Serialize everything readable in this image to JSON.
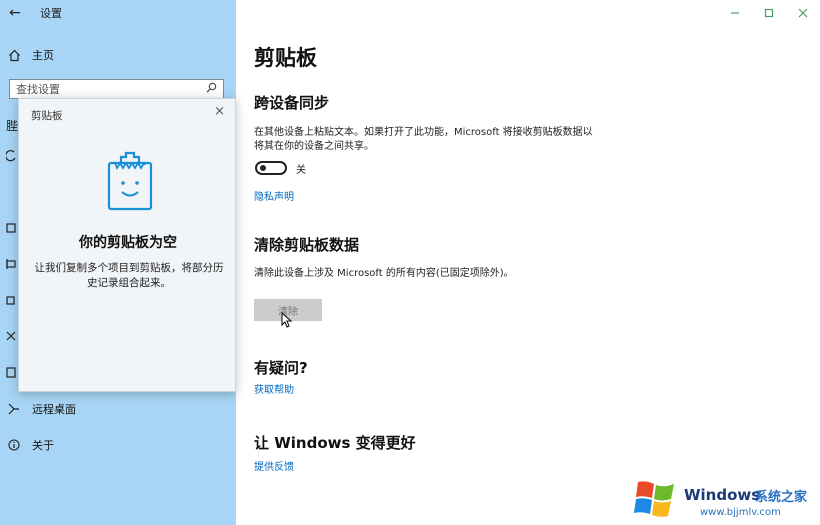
{
  "window": {
    "title": "设置"
  },
  "sidebar": {
    "home_label": "主页",
    "search_placeholder": "查找设置",
    "items": [
      {
        "label": "远程桌面",
        "icon": "remote-desktop-icon"
      },
      {
        "label": "关于",
        "icon": "info-icon"
      }
    ]
  },
  "popup": {
    "title": "剪贴板",
    "heading": "你的剪贴板为空",
    "text": "让我们复制多个项目到剪贴板，将部分历史记录组合起来。"
  },
  "main": {
    "page_title": "剪贴板",
    "sync": {
      "title": "跨设备同步",
      "desc": "在其他设备上粘贴文本。如果打开了此功能，Microsoft 将接收剪贴板数据以将其在你的设备之间共享。",
      "toggle_state": "关",
      "link": "隐私声明"
    },
    "clear": {
      "title": "清除剪贴板数据",
      "desc": "清除此设备上涉及 Microsoft 的所有内容(已固定项除外)。",
      "button": "清除"
    },
    "question": {
      "title": "有疑问?",
      "link": "获取帮助"
    },
    "improve": {
      "title": "让 Windows 变得更好",
      "link": "提供反馈"
    }
  },
  "watermark": {
    "brand": "Windows",
    "brand_cn": "系统之家",
    "url": "www.bjjmlv.com"
  },
  "colors": {
    "sidebar_bg": "#a8d5f5",
    "link": "#0067c0",
    "window_controls": "#4a9a6a"
  }
}
